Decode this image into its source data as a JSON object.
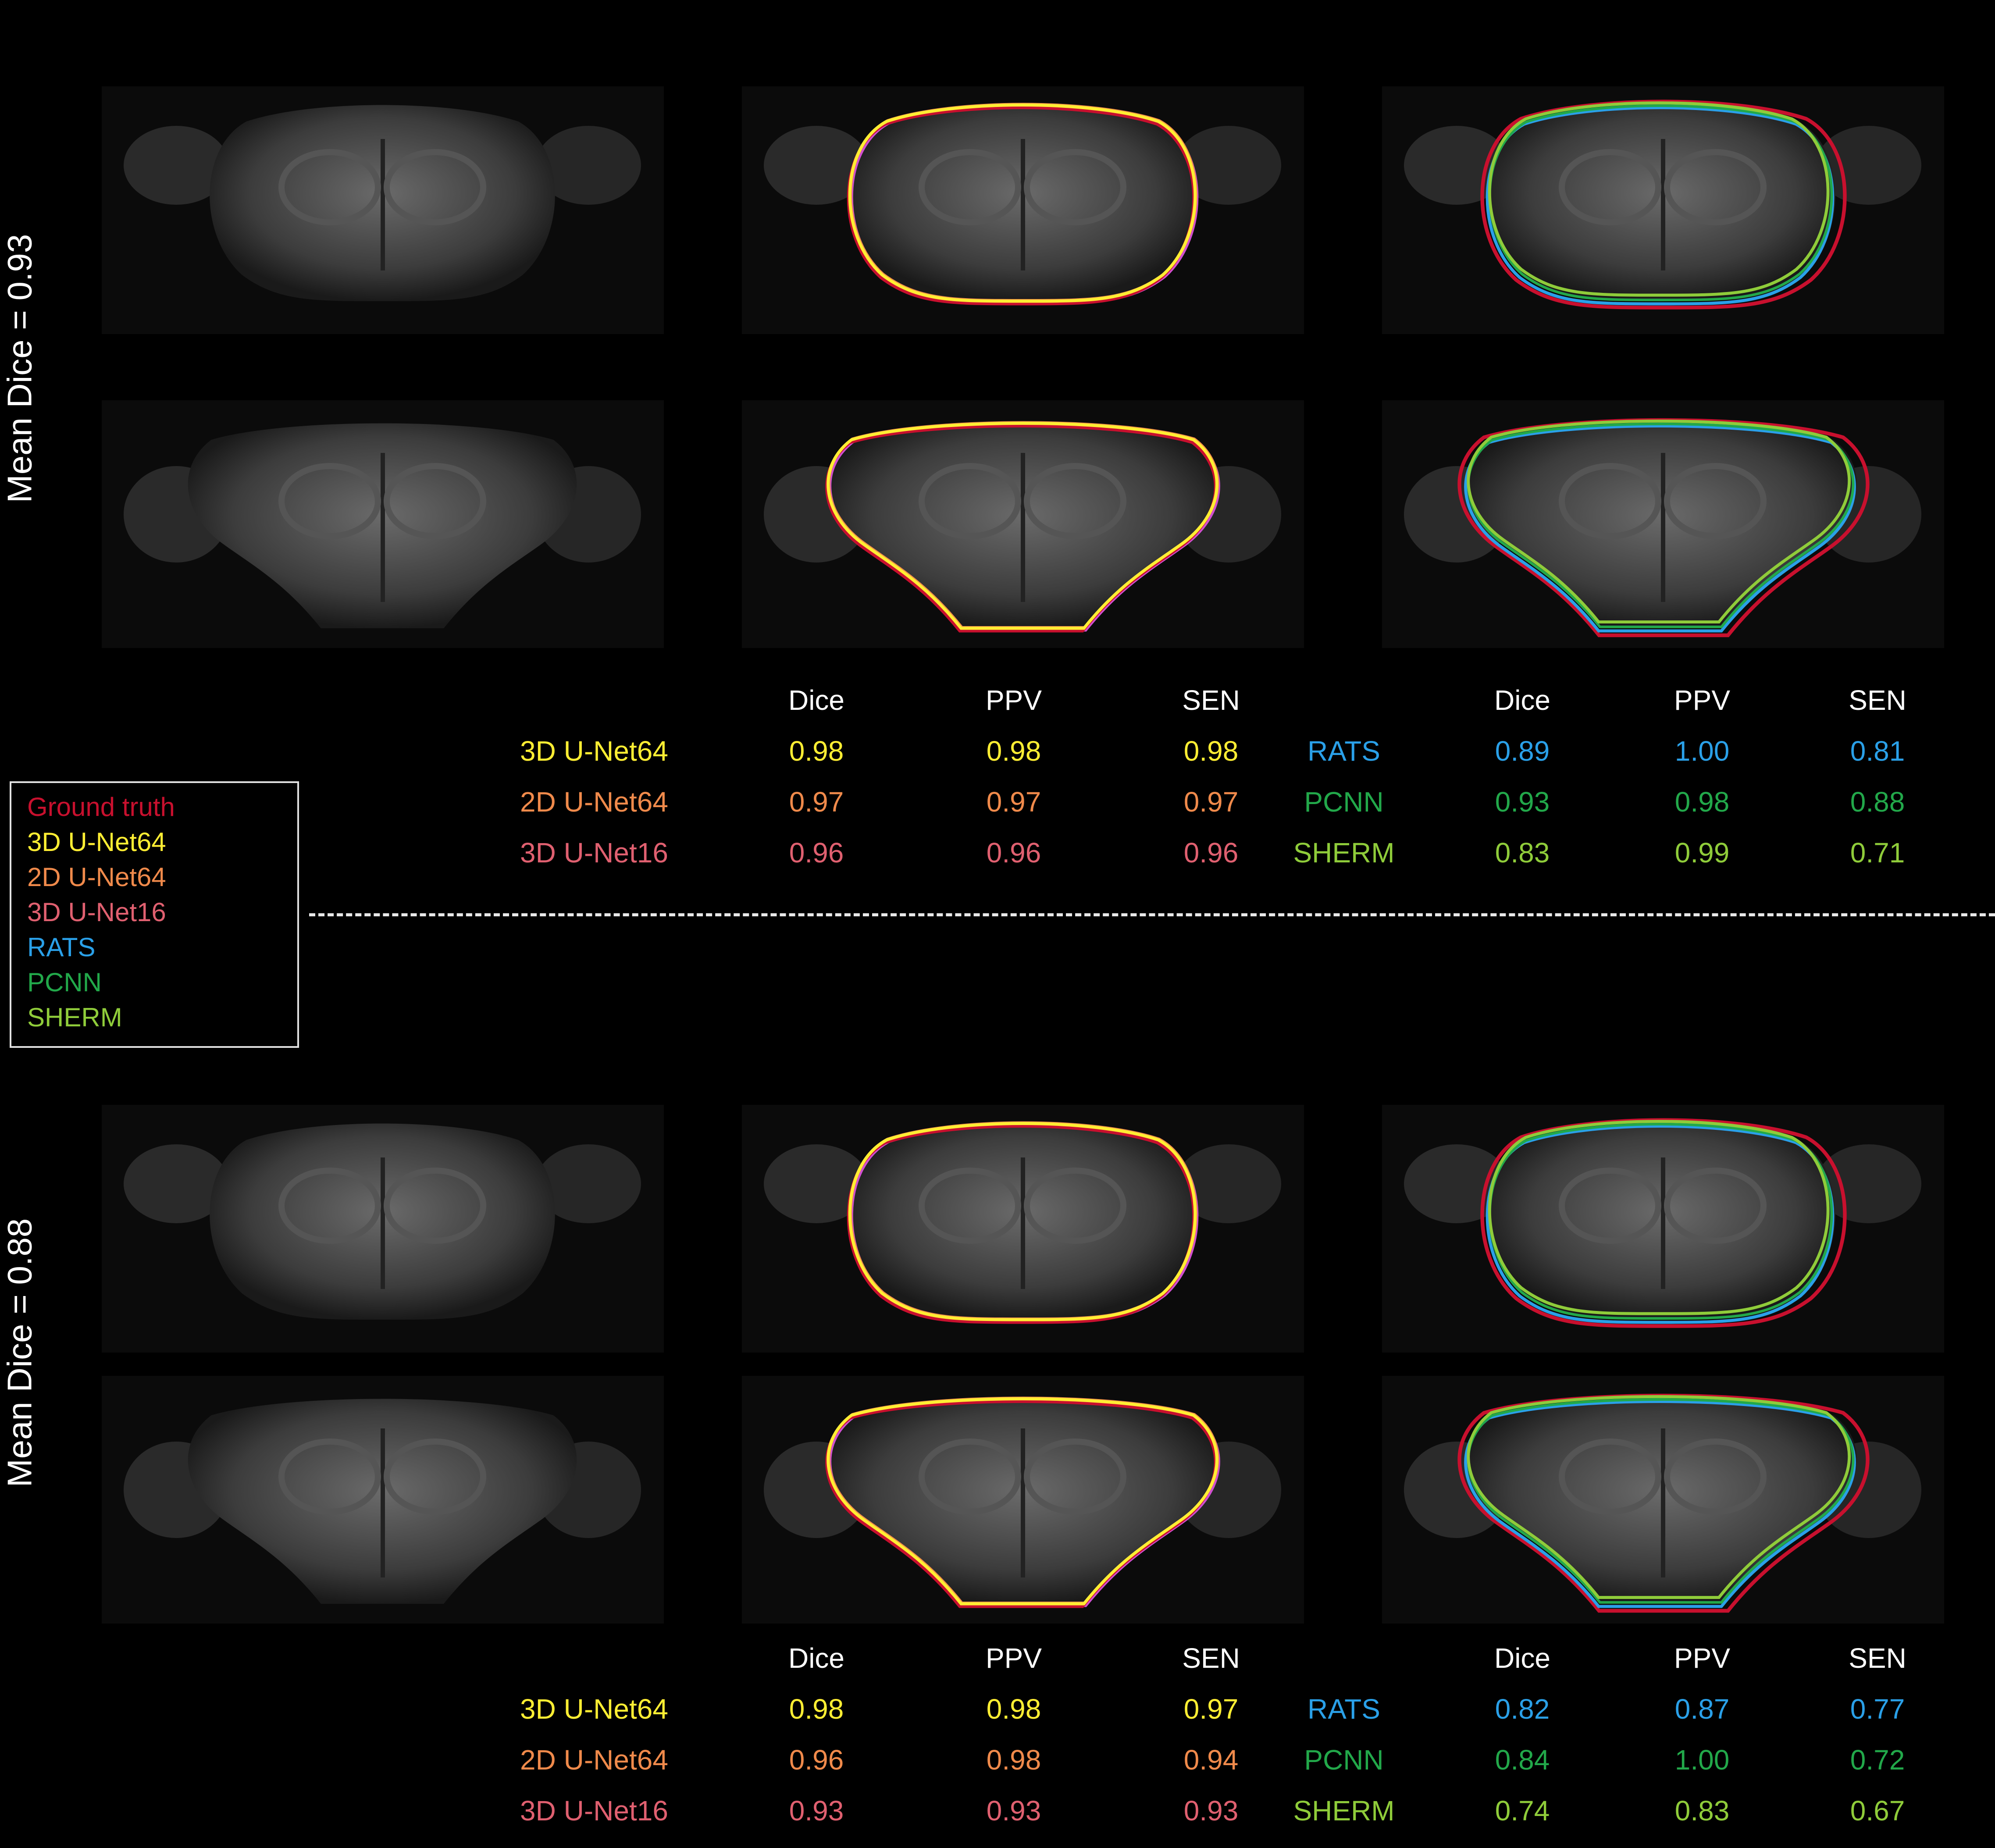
{
  "row_labels": {
    "top": "Mean Dice = 0.93",
    "bottom": "Mean Dice = 0.88"
  },
  "legend": [
    {
      "label": "Ground truth",
      "color": "#c8102e"
    },
    {
      "label": "3D U-Net64",
      "color": "#ffee33"
    },
    {
      "label": "2D U-Net64",
      "color": "#f08a4b"
    },
    {
      "label": "3D U-Net16",
      "color": "#e06070"
    },
    {
      "label": "RATS",
      "color": "#2aa0e8"
    },
    {
      "label": "PCNN",
      "color": "#22a84a"
    },
    {
      "label": "SHERM",
      "color": "#8fcc3a"
    }
  ],
  "tables": [
    {
      "headers": [
        "Dice",
        "PPV",
        "SEN"
      ],
      "left": [
        {
          "name": "3D U-Net64",
          "color": "#ffee33",
          "values": [
            "0.98",
            "0.98",
            "0.98"
          ]
        },
        {
          "name": "2D U-Net64",
          "color": "#f08a4b",
          "values": [
            "0.97",
            "0.97",
            "0.97"
          ]
        },
        {
          "name": "3D U-Net16",
          "color": "#e06070",
          "values": [
            "0.96",
            "0.96",
            "0.96"
          ]
        }
      ],
      "right": [
        {
          "name": "RATS",
          "color": "#2aa0e8",
          "values": [
            "0.89",
            "1.00",
            "0.81"
          ]
        },
        {
          "name": "PCNN",
          "color": "#22a84a",
          "values": [
            "0.93",
            "0.98",
            "0.88"
          ]
        },
        {
          "name": "SHERM",
          "color": "#8fcc3a",
          "values": [
            "0.83",
            "0.99",
            "0.71"
          ]
        }
      ]
    },
    {
      "headers": [
        "Dice",
        "PPV",
        "SEN"
      ],
      "left": [
        {
          "name": "3D U-Net64",
          "color": "#ffee33",
          "values": [
            "0.98",
            "0.98",
            "0.97"
          ]
        },
        {
          "name": "2D U-Net64",
          "color": "#f08a4b",
          "values": [
            "0.96",
            "0.98",
            "0.94"
          ]
        },
        {
          "name": "3D U-Net16",
          "color": "#e06070",
          "values": [
            "0.93",
            "0.93",
            "0.93"
          ]
        }
      ],
      "right": [
        {
          "name": "RATS",
          "color": "#2aa0e8",
          "values": [
            "0.82",
            "0.87",
            "0.77"
          ]
        },
        {
          "name": "PCNN",
          "color": "#22a84a",
          "values": [
            "0.84",
            "1.00",
            "0.72"
          ]
        },
        {
          "name": "SHERM",
          "color": "#8fcc3a",
          "values": [
            "0.74",
            "0.83",
            "0.67"
          ]
        }
      ]
    }
  ],
  "colors": {
    "ground_truth": "#c8102e",
    "unet64_3d": "#ffee33",
    "unet64_2d": "#f08a4b",
    "unet16_3d": "#d050d0",
    "rats": "#2aa0e8",
    "pcnn": "#22a84a",
    "sherm": "#8fcc3a"
  }
}
